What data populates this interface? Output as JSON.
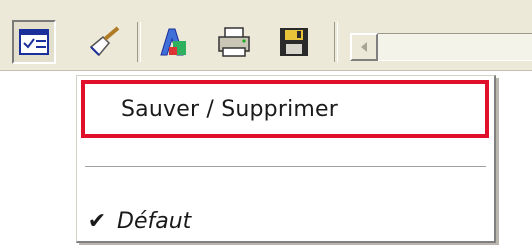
{
  "toolbar": {
    "buttons": [
      {
        "name": "check-grid-icon",
        "pressed": true
      },
      {
        "name": "brush-icon",
        "pressed": false
      },
      {
        "name": "text-tool-icon",
        "pressed": false
      },
      {
        "name": "printer-icon",
        "pressed": false
      },
      {
        "name": "floppy-disk-icon",
        "pressed": false
      }
    ],
    "scroll_arrow_icon": "triangle-left-icon"
  },
  "menu": {
    "items": {
      "save_delete": "Sauver / Supprimer",
      "default": "Défaut"
    },
    "default_checked": true,
    "check_glyph": "✔",
    "highlight_color": "#e0102a"
  }
}
